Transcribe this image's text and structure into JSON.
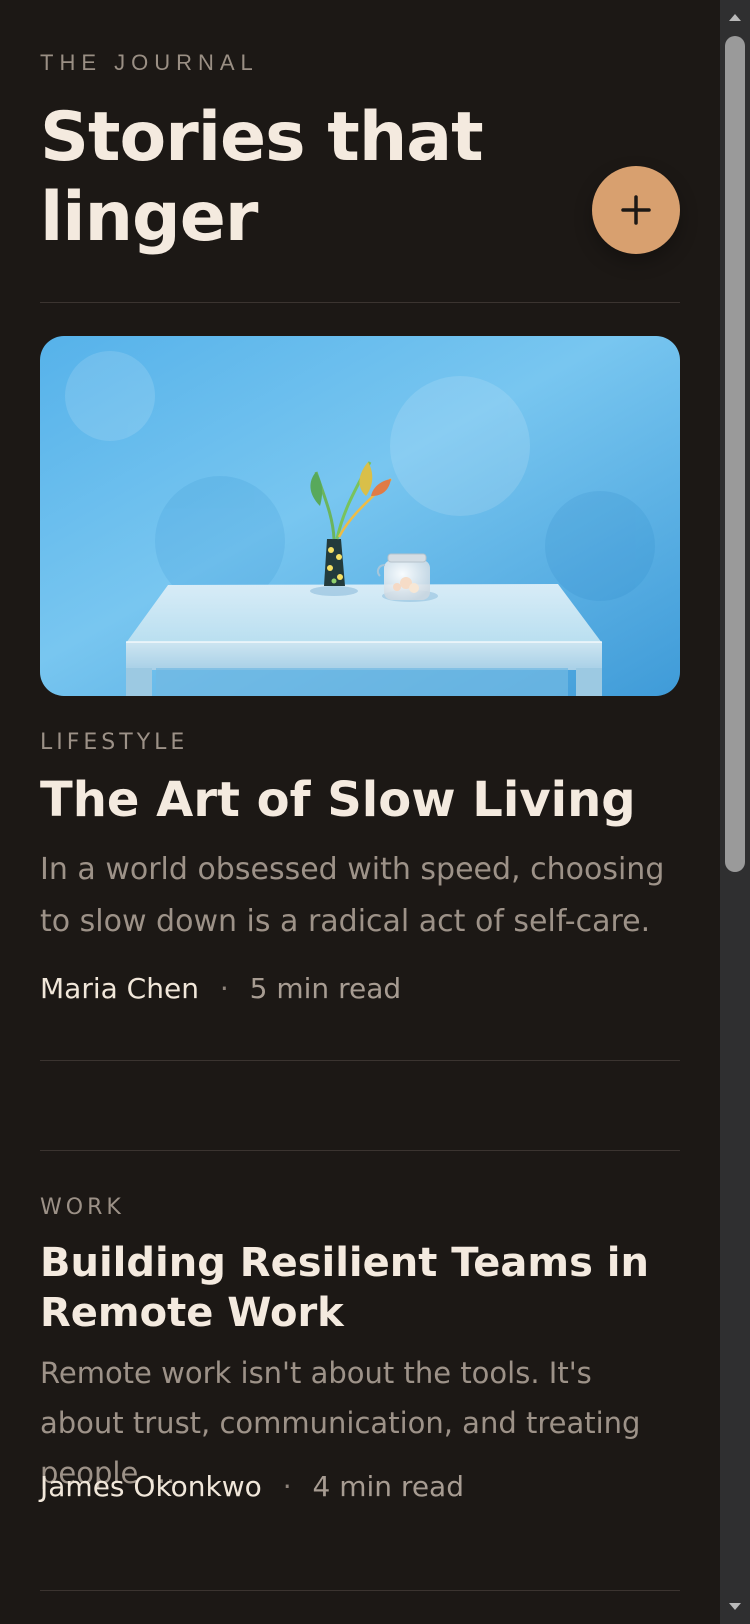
{
  "header": {
    "eyebrow": "THE JOURNAL",
    "title_line_1": "Stories that",
    "title_line_2": "linger",
    "fab_icon": "plus-icon",
    "accent_color": "#d8a06f"
  },
  "stories": [
    {
      "category": "LIFESTYLE",
      "title": "The Art of Slow Living",
      "excerpt": "In a world obsessed with speed, choosing to slow down is a radical act of self-care.",
      "author": "Maria Chen",
      "separator": "·",
      "read_time": "5 min read",
      "image_icon": "still-life-photo-icon"
    },
    {
      "category": "WORK",
      "title": "Building Resilient Teams in Remote Work",
      "excerpt": "Remote work isn't about the tools. It's about trust, communication, and treating people ...",
      "author": "James Okonkwo",
      "separator": "·",
      "read_time": "4 min read"
    }
  ],
  "scrollbar": {
    "up_icon": "scroll-up-arrow-icon",
    "down_icon": "scroll-down-arrow-icon"
  }
}
